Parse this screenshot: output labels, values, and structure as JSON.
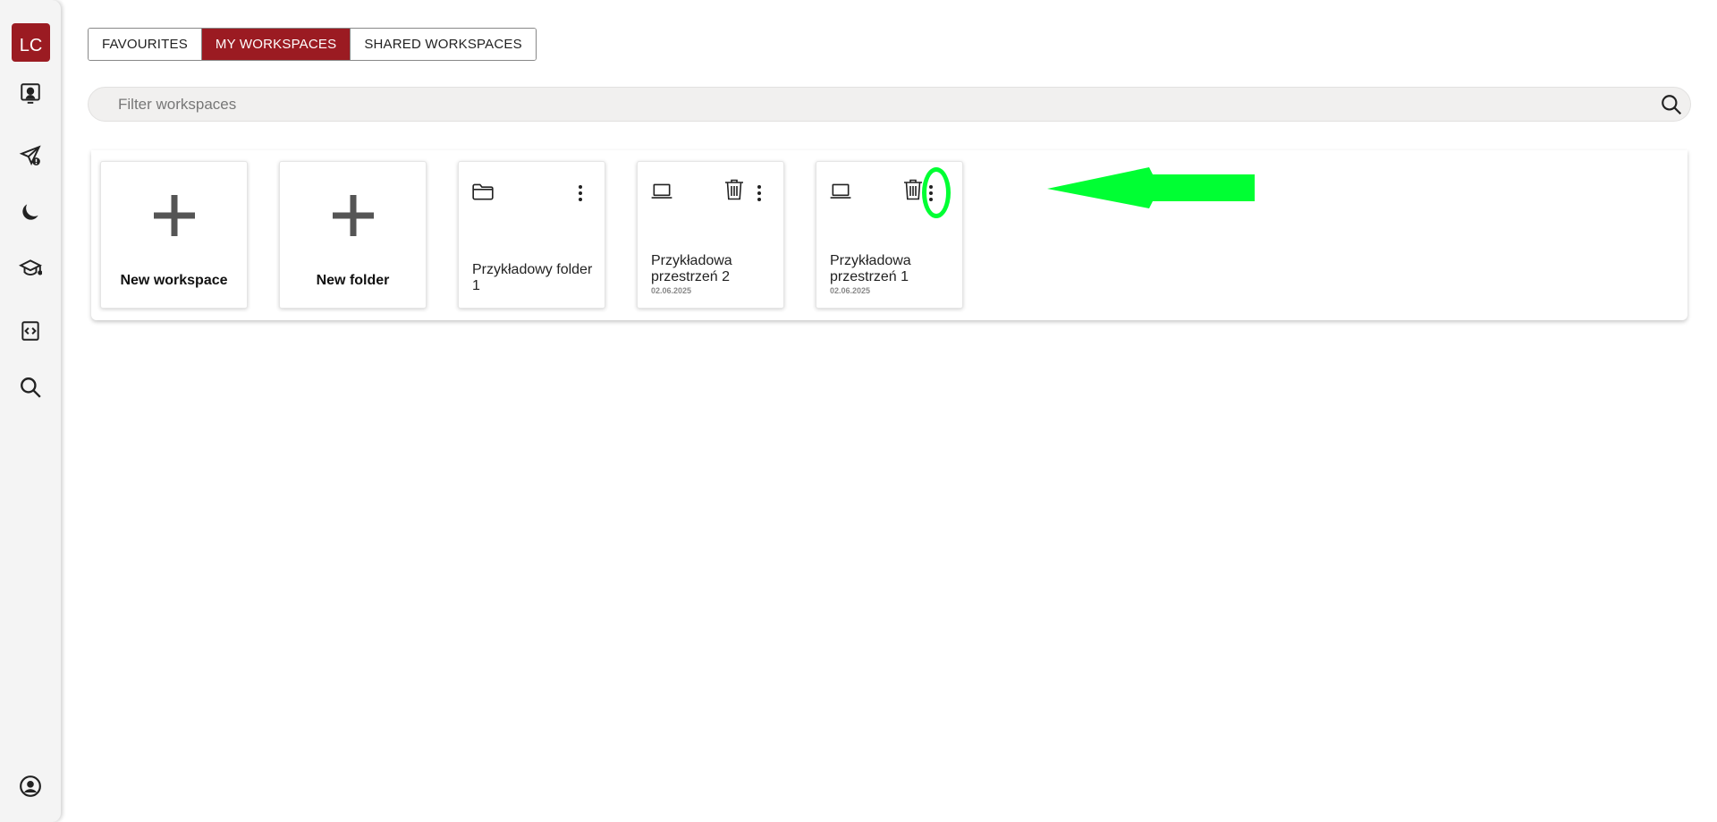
{
  "sidebar": {
    "avatar_initials": "LC",
    "items": [
      {
        "icon": "presentation-icon"
      },
      {
        "icon": "send-alert-icon"
      },
      {
        "icon": "moon-icon"
      },
      {
        "icon": "graduation-cap-icon"
      },
      {
        "icon": "code-file-icon"
      },
      {
        "icon": "search-icon"
      }
    ],
    "bottom_icon": "user-circle-icon"
  },
  "tabs": [
    {
      "label": "FAVOURITES",
      "active": false
    },
    {
      "label": "MY WORKSPACES",
      "active": true
    },
    {
      "label": "SHARED WORKSPACES",
      "active": false
    }
  ],
  "filter": {
    "placeholder": "Filter workspaces",
    "value": ""
  },
  "cards": {
    "new_workspace": {
      "label": "New workspace"
    },
    "new_folder": {
      "label": "New folder"
    },
    "folder_1": {
      "type": "folder",
      "title": "Przykładowy folder 1"
    },
    "workspace_2": {
      "type": "workspace",
      "title": "Przykładowa przestrzeń 2",
      "date": "02.06.2025"
    },
    "workspace_1": {
      "type": "workspace",
      "title": "Przykładowa przestrzeń 1",
      "date": "02.06.2025"
    }
  },
  "colors": {
    "brand": "#9b1b22",
    "annotation": "#00ff33"
  }
}
